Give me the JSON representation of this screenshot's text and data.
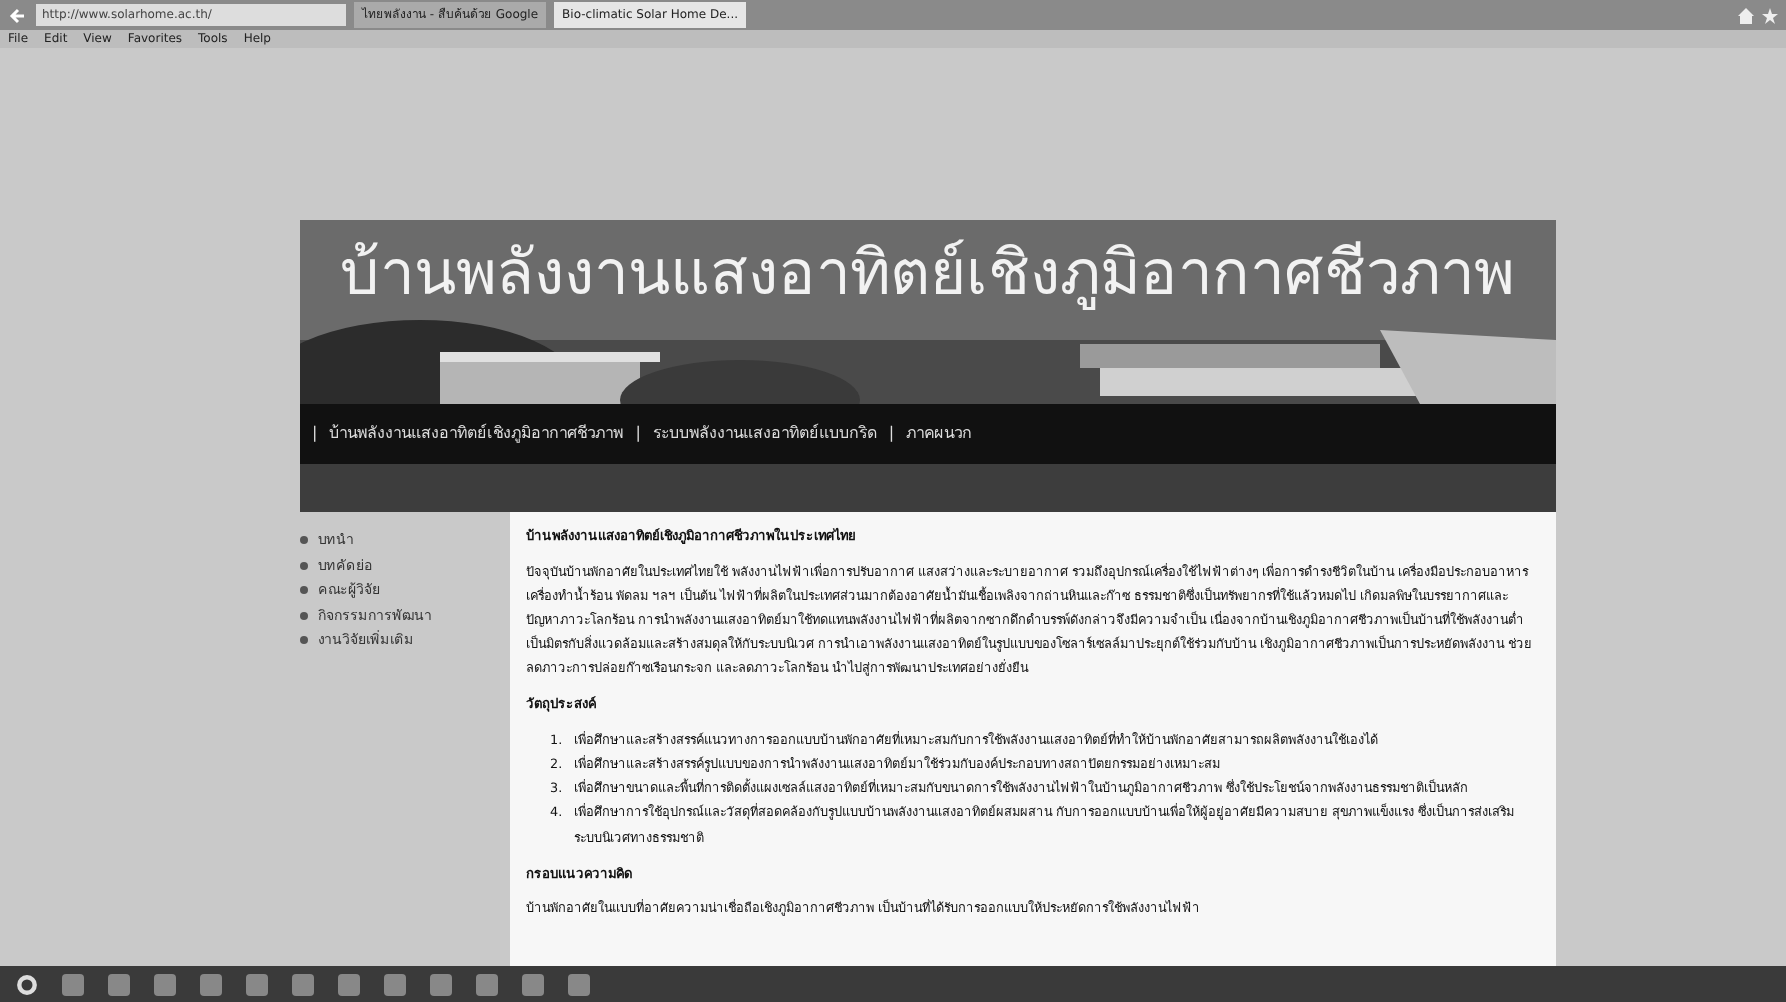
{
  "browser": {
    "address": "http://www.solarhome.ac.th/",
    "tabs": [
      {
        "label": "ไทยพลังงาน - สืบค้นด้วย Google",
        "selected": false
      },
      {
        "label": "Bio-climatic Solar Home De...",
        "selected": true
      }
    ],
    "menu": [
      "File",
      "Edit",
      "View",
      "Favorites",
      "Tools",
      "Help"
    ]
  },
  "site": {
    "title": "บ้านพลังงานแสงอาทิตย์เชิงภูมิอากาศชีวภาพ",
    "nav_separator": "|",
    "nav": [
      "บ้านพลังงานแสงอาทิตย์เชิงภูมิอากาศชีวภาพ",
      "ระบบพลังงานแสงอาทิตย์แบบกริด",
      "ภาคผนวก"
    ],
    "sidebar": [
      "บทนำ",
      "บทคัดย่อ",
      "คณะผู้วิจัย",
      "กิจกรรมการพัฒนา",
      "งานวิจัยเพิ่มเติม"
    ],
    "heading": "บ้านพลังงานแสงอาทิตย์เชิงภูมิอากาศชีวภาพในประเทศไทย",
    "intro": "ปัจจุบันบ้านพักอาศัยในประเทศไทยใช้ พลังงานไฟฟ้าเพื่อการปรับอากาศ แสงสว่างและระบายอากาศ รวมถึงอุปกรณ์เครื่องใช้ไฟฟ้าต่างๆ เพื่อการดำรงชีวิตในบ้าน เครื่องมือประกอบอาหาร เครื่องทำน้ำร้อน พัดลม ฯลฯ เป็นต้น ไฟฟ้าที่ผลิตในประเทศส่วนมากต้องอาศัยน้ำมันเชื้อเพลิงจากถ่านหินและก๊าซ ธรรมชาติซึ่งเป็นทรัพยากรที่ใช้แล้วหมดไป เกิดมลพิษในบรรยากาศและปัญหาภาวะโลกร้อน การนำพลังงานแสงอาทิตย์มาใช้ทดแทนพลังงานไฟฟ้าที่ผลิตจากซากดึกดำบรรพ์ดังกล่าวจึงมีความจำเป็น เนื่องจากบ้านเชิงภูมิอากาศชีวภาพเป็นบ้านที่ใช้พลังงานต่ำ เป็นมิตรกับสิ่งแวดล้อมและสร้างสมดุลให้กับระบบนิเวศ การนำเอาพลังงานแสงอาทิตย์ในรูปแบบของโซลาร์เซลล์มาประยุกต์ใช้ร่วมกับบ้าน เชิงภูมิอากาศชีวภาพเป็นการประหยัดพลังงาน ช่วยลดภาวะการปล่อยก๊าซเรือนกระจก และลดภาวะโลกร้อน นำไปสู่การพัฒนาประเทศอย่างยั่งยืน",
    "objectives_heading": "วัตถุประสงค์",
    "objective_numbers": [
      "1.",
      "2.",
      "3.",
      "4."
    ],
    "objectives": [
      "เพื่อศึกษาและสร้างสรรค์แนวทางการออกแบบบ้านพักอาศัยที่เหมาะสมกับการใช้พลังงานแสงอาทิตย์ที่ทำให้บ้านพักอาศัยสามารถผลิตพลังงานใช้เองได้",
      "เพื่อศึกษาและสร้างสรรค์รูปแบบของการนำพลังงานแสงอาทิตย์มาใช้ร่วมกับองค์ประกอบทางสถาปัตยกรรมอย่างเหมาะสม",
      "เพื่อศึกษาขนาดและพื้นที่การติดตั้งแผงเซลล์แสงอาทิตย์ที่เหมาะสมกับขนาดการใช้พลังงานไฟฟ้าในบ้านภูมิอากาศชีวภาพ ซึ่งใช้ประโยชน์จากพลังงานธรรมชาติเป็นหลัก",
      "เพื่อศึกษาการใช้อุปกรณ์และวัสดุที่สอดคล้องกับรูปแบบบ้านพลังงานแสงอาทิตย์ผสมผสาน กับการออกแบบบ้านเพื่อให้ผู้อยู่อาศัยมีความสบาย สุขภาพแข็งแรง ซึ่งเป็นการส่งเสริมระบบนิเวศทางธรรมชาติ"
    ],
    "framework_heading": "กรอบแนวความคิด",
    "framework_text": "บ้านพักอาศัยในแบบที่อาศัยความน่าเชื่อถือเชิงภูมิอากาศชีวภาพ เป็นบ้านที่ได้รับการออกแบบให้ประหยัดการใช้พลังงานไฟฟ้า"
  }
}
